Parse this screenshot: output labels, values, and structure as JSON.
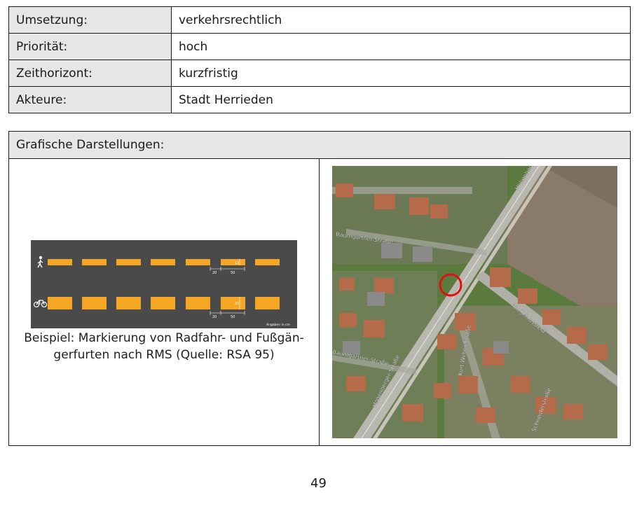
{
  "details": [
    {
      "label": "Umsetzung:",
      "value": "verkehrsrechtlich"
    },
    {
      "label": "Priorität:",
      "value": "hoch"
    },
    {
      "label": "Zeithorizont:",
      "value": "kurzfristig"
    },
    {
      "label": "Akteure:",
      "value": "Stadt Herrieden"
    }
  ],
  "graphics": {
    "header": "Grafische Darstellungen:",
    "caption_line1": "Beispiel: Markierung von Radfahr- und Fußgän-",
    "caption_line2": "gerfurten nach RMS (Quelle: RSA 95)",
    "marking": {
      "dim_a": "20",
      "dim_b": "50",
      "dim_ped_height": "12",
      "dim_bike_height": "25",
      "unit_note": "Angaben in cm",
      "marking_color": "#f5a623"
    },
    "map": {
      "street_1": "Baumgärtner-Straße",
      "street_2": "Hohenberger Straße",
      "street_3": "Am Schlossfeld",
      "street_4": "Kurt-Weber-Straße",
      "street_5": "Schneiderstraße",
      "street_6": "Hohenberger-Straße",
      "street_7": "Baumgärtner-Straße",
      "marker_color": "#e01010"
    }
  },
  "page_number": "49"
}
